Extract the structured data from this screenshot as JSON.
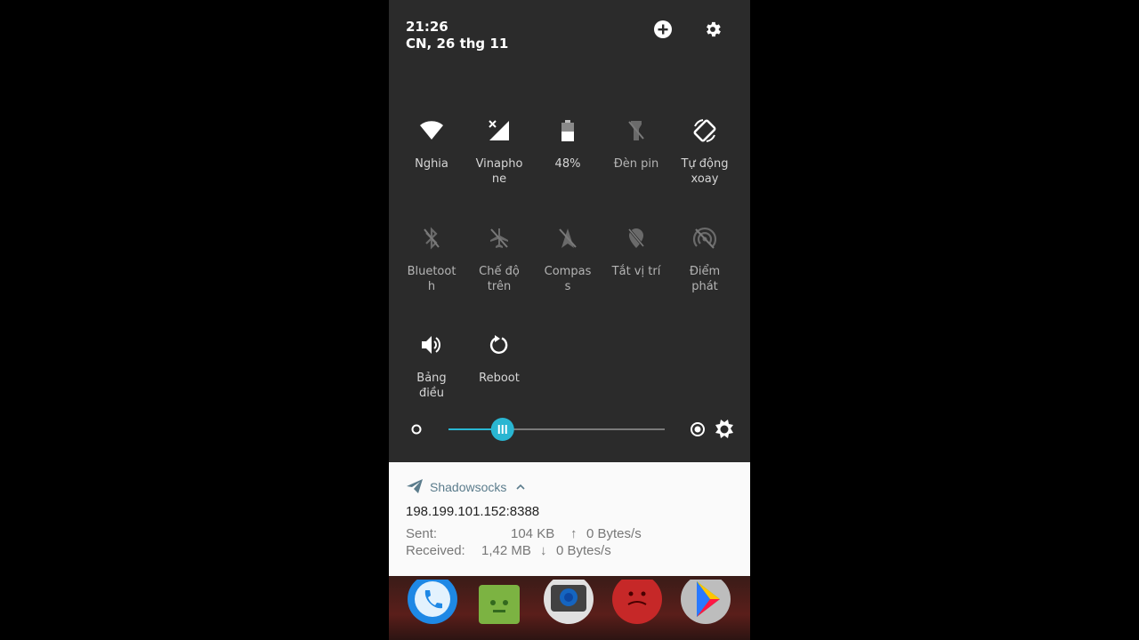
{
  "status": {
    "time": "21:26",
    "date": "CN, 26 thg 11"
  },
  "header_icons": [
    "add-circle-icon",
    "gear-icon"
  ],
  "tiles": [
    {
      "label": "Nghia",
      "icon": "wifi-icon",
      "active": true
    },
    {
      "label": "Vinapho\nne",
      "icon": "signal-icon",
      "active": true
    },
    {
      "label": "48%",
      "icon": "battery-icon",
      "active": true
    },
    {
      "label": "Đèn pin",
      "icon": "flashlight-off-icon",
      "active": false
    },
    {
      "label": "Tự động\nxoay",
      "icon": "auto-rotate-icon",
      "active": true
    },
    {
      "label": "Bluetoot\nh",
      "icon": "bluetooth-off-icon",
      "active": false
    },
    {
      "label": "Chế độ\ntrên",
      "icon": "airplane-icon",
      "active": false
    },
    {
      "label": "Compas\ns",
      "icon": "compass-off-icon",
      "active": false
    },
    {
      "label": "Tắt vị trí",
      "icon": "location-off-icon",
      "active": false
    },
    {
      "label": "Điểm\nphát",
      "icon": "hotspot-off-icon",
      "active": false
    },
    {
      "label": "Bảng\nđiều",
      "icon": "volume-icon",
      "active": true
    },
    {
      "label": "Reboot",
      "icon": "reboot-icon",
      "active": true
    }
  ],
  "brightness": {
    "level": 0.25,
    "accent": "#29b6d2"
  },
  "notification": {
    "app_name": "Shadowsocks",
    "title": "198.199.101.152:8388",
    "sent_label": "Sent:",
    "sent_total": "104 KB",
    "sent_arrow": "↑",
    "sent_rate": "0 Bytes/s",
    "received_label": "Received:",
    "received_total": "1,42 MB",
    "received_arrow": "↓",
    "received_rate": "0 Bytes/s"
  },
  "dock_apps": [
    {
      "name": "phone-app-icon",
      "color": "#1e88e5"
    },
    {
      "name": "messaging-app-icon",
      "color": "#7cb342"
    },
    {
      "name": "camera-app-icon",
      "color": "#424242"
    },
    {
      "name": "red-app-icon",
      "color": "#c62828"
    },
    {
      "name": "play-store-icon",
      "color": "#9e9e9e"
    }
  ]
}
